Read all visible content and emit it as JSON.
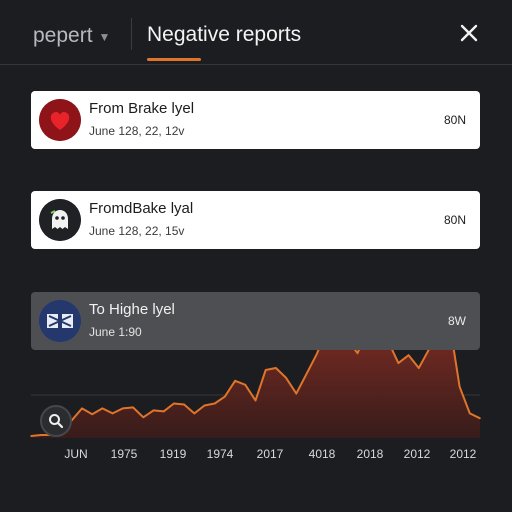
{
  "header": {
    "report_tab_label": "pepert",
    "negative_tab_label": "Negative reports",
    "close_icon": "close-icon"
  },
  "reports": [
    {
      "avatar_icon": "heart-icon",
      "title": "From Brake lyel",
      "subtitle": "June 128, 22, 12v",
      "metric": "80N"
    },
    {
      "avatar_icon": "ghost-icon",
      "title": "FromdBake lyal",
      "subtitle": "June 128, 22, 15v",
      "metric": "80N"
    },
    {
      "avatar_icon": "crest-icon",
      "title": "To Highe lyel",
      "subtitle": "June 1:90",
      "metric": "8W"
    }
  ],
  "search_icon": "search-icon",
  "colors": {
    "accent": "#e0742a",
    "area_fill": "#7a2b22",
    "area_line": "#e0742a",
    "background": "#1c1d20"
  },
  "chart_data": {
    "type": "area",
    "title": "",
    "xlabel": "",
    "ylabel": "",
    "tick_labels": [
      "JUN",
      "1975",
      "1919",
      "1974",
      "2017",
      "4018",
      "2018",
      "2012",
      "2012"
    ],
    "series": [
      {
        "values": [
          2,
          3,
          3,
          5,
          18,
          30,
          24,
          30,
          25,
          30,
          31,
          21,
          28,
          27,
          35,
          34,
          25,
          33,
          35,
          42,
          58,
          54,
          38,
          69,
          71,
          61,
          45,
          65,
          85,
          110,
          116,
          100,
          86,
          110,
          130,
          98,
          76,
          84,
          71,
          90,
          110,
          118,
          52,
          25,
          20
        ]
      }
    ],
    "ylim": [
      0,
      140
    ],
    "grid": false,
    "legend": "none"
  }
}
